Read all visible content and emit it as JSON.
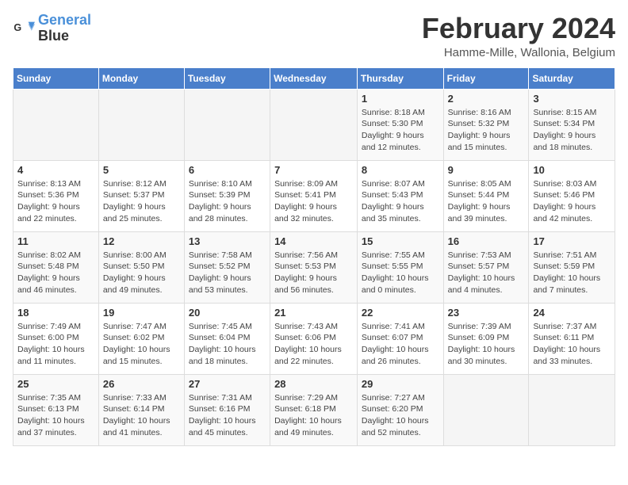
{
  "logo": {
    "line1": "General",
    "line2": "Blue"
  },
  "title": "February 2024",
  "subtitle": "Hamme-Mille, Wallonia, Belgium",
  "days_of_week": [
    "Sunday",
    "Monday",
    "Tuesday",
    "Wednesday",
    "Thursday",
    "Friday",
    "Saturday"
  ],
  "weeks": [
    [
      {
        "day": "",
        "info": ""
      },
      {
        "day": "",
        "info": ""
      },
      {
        "day": "",
        "info": ""
      },
      {
        "day": "",
        "info": ""
      },
      {
        "day": "1",
        "info": "Sunrise: 8:18 AM\nSunset: 5:30 PM\nDaylight: 9 hours\nand 12 minutes."
      },
      {
        "day": "2",
        "info": "Sunrise: 8:16 AM\nSunset: 5:32 PM\nDaylight: 9 hours\nand 15 minutes."
      },
      {
        "day": "3",
        "info": "Sunrise: 8:15 AM\nSunset: 5:34 PM\nDaylight: 9 hours\nand 18 minutes."
      }
    ],
    [
      {
        "day": "4",
        "info": "Sunrise: 8:13 AM\nSunset: 5:36 PM\nDaylight: 9 hours\nand 22 minutes."
      },
      {
        "day": "5",
        "info": "Sunrise: 8:12 AM\nSunset: 5:37 PM\nDaylight: 9 hours\nand 25 minutes."
      },
      {
        "day": "6",
        "info": "Sunrise: 8:10 AM\nSunset: 5:39 PM\nDaylight: 9 hours\nand 28 minutes."
      },
      {
        "day": "7",
        "info": "Sunrise: 8:09 AM\nSunset: 5:41 PM\nDaylight: 9 hours\nand 32 minutes."
      },
      {
        "day": "8",
        "info": "Sunrise: 8:07 AM\nSunset: 5:43 PM\nDaylight: 9 hours\nand 35 minutes."
      },
      {
        "day": "9",
        "info": "Sunrise: 8:05 AM\nSunset: 5:44 PM\nDaylight: 9 hours\nand 39 minutes."
      },
      {
        "day": "10",
        "info": "Sunrise: 8:03 AM\nSunset: 5:46 PM\nDaylight: 9 hours\nand 42 minutes."
      }
    ],
    [
      {
        "day": "11",
        "info": "Sunrise: 8:02 AM\nSunset: 5:48 PM\nDaylight: 9 hours\nand 46 minutes."
      },
      {
        "day": "12",
        "info": "Sunrise: 8:00 AM\nSunset: 5:50 PM\nDaylight: 9 hours\nand 49 minutes."
      },
      {
        "day": "13",
        "info": "Sunrise: 7:58 AM\nSunset: 5:52 PM\nDaylight: 9 hours\nand 53 minutes."
      },
      {
        "day": "14",
        "info": "Sunrise: 7:56 AM\nSunset: 5:53 PM\nDaylight: 9 hours\nand 56 minutes."
      },
      {
        "day": "15",
        "info": "Sunrise: 7:55 AM\nSunset: 5:55 PM\nDaylight: 10 hours\nand 0 minutes."
      },
      {
        "day": "16",
        "info": "Sunrise: 7:53 AM\nSunset: 5:57 PM\nDaylight: 10 hours\nand 4 minutes."
      },
      {
        "day": "17",
        "info": "Sunrise: 7:51 AM\nSunset: 5:59 PM\nDaylight: 10 hours\nand 7 minutes."
      }
    ],
    [
      {
        "day": "18",
        "info": "Sunrise: 7:49 AM\nSunset: 6:00 PM\nDaylight: 10 hours\nand 11 minutes."
      },
      {
        "day": "19",
        "info": "Sunrise: 7:47 AM\nSunset: 6:02 PM\nDaylight: 10 hours\nand 15 minutes."
      },
      {
        "day": "20",
        "info": "Sunrise: 7:45 AM\nSunset: 6:04 PM\nDaylight: 10 hours\nand 18 minutes."
      },
      {
        "day": "21",
        "info": "Sunrise: 7:43 AM\nSunset: 6:06 PM\nDaylight: 10 hours\nand 22 minutes."
      },
      {
        "day": "22",
        "info": "Sunrise: 7:41 AM\nSunset: 6:07 PM\nDaylight: 10 hours\nand 26 minutes."
      },
      {
        "day": "23",
        "info": "Sunrise: 7:39 AM\nSunset: 6:09 PM\nDaylight: 10 hours\nand 30 minutes."
      },
      {
        "day": "24",
        "info": "Sunrise: 7:37 AM\nSunset: 6:11 PM\nDaylight: 10 hours\nand 33 minutes."
      }
    ],
    [
      {
        "day": "25",
        "info": "Sunrise: 7:35 AM\nSunset: 6:13 PM\nDaylight: 10 hours\nand 37 minutes."
      },
      {
        "day": "26",
        "info": "Sunrise: 7:33 AM\nSunset: 6:14 PM\nDaylight: 10 hours\nand 41 minutes."
      },
      {
        "day": "27",
        "info": "Sunrise: 7:31 AM\nSunset: 6:16 PM\nDaylight: 10 hours\nand 45 minutes."
      },
      {
        "day": "28",
        "info": "Sunrise: 7:29 AM\nSunset: 6:18 PM\nDaylight: 10 hours\nand 49 minutes."
      },
      {
        "day": "29",
        "info": "Sunrise: 7:27 AM\nSunset: 6:20 PM\nDaylight: 10 hours\nand 52 minutes."
      },
      {
        "day": "",
        "info": ""
      },
      {
        "day": "",
        "info": ""
      }
    ]
  ]
}
